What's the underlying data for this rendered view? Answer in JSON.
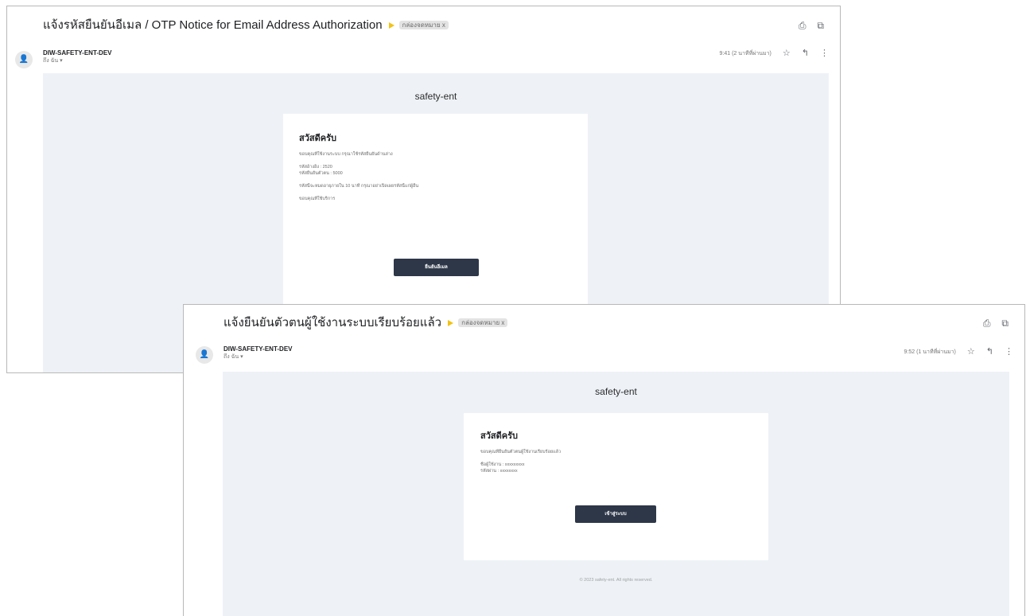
{
  "windows": [
    {
      "subject": "แจ้งรหัสยืนยันอีเมล / OTP Notice for Email Address Authorization",
      "label": "กล่องจดหมาย x",
      "sender_name": "DIW-SAFETY-ENT-DEV",
      "sender_to": "ถึง ฉัน ▾",
      "time": "9:41 (2 นาทีที่ผ่านมา)",
      "brand": "safety-ent",
      "greeting": "สวัสดีครับ",
      "lines": [
        "ขอบคุณที่ใช้งานระบบ กรุณาใช้รหัสยืนยันด้านล่าง",
        "รหัสอ้างอิง : 2520",
        "รหัสยืนยันตัวตน : 5000",
        "รหัสนี้จะหมดอายุภายใน 10 นาที กรุณาอย่าเปิดเผยรหัสนี้แก่ผู้อื่น",
        "ขอบคุณที่ใช้บริการ"
      ],
      "button": "ยืนยันอีเมล"
    },
    {
      "subject": "แจ้งยืนยันตัวตนผู้ใช้งานระบบเรียบร้อยแล้ว",
      "label": "กล่องจดหมาย x",
      "sender_name": "DIW-SAFETY-ENT-DEV",
      "sender_to": "ถึง ฉัน ▾",
      "time": "9:52 (1 นาทีที่ผ่านมา)",
      "brand": "safety-ent",
      "greeting": "สวัสดีครับ",
      "lines": [
        "ขอบคุณที่ยืนยันตัวตนผู้ใช้งานเรียบร้อยแล้ว",
        "ชื่อผู้ใช้งาน : xxxxxxxxx",
        "รหัสผ่าน : xxxxxxxx"
      ],
      "button": "เข้าสู่ระบบ",
      "footer": "© 2023 safety-ent. All rights reserved."
    }
  ],
  "icons": {
    "print": "print-icon",
    "open_new": "open-in-new-icon",
    "star": "star-icon",
    "reply": "reply-icon",
    "more": "more-vert-icon",
    "important": "important-marker-icon",
    "avatar": "avatar-icon"
  },
  "colors": {
    "mail_background": "#eef2f7",
    "button": "#2d3748",
    "important_marker": "#f2c315"
  }
}
